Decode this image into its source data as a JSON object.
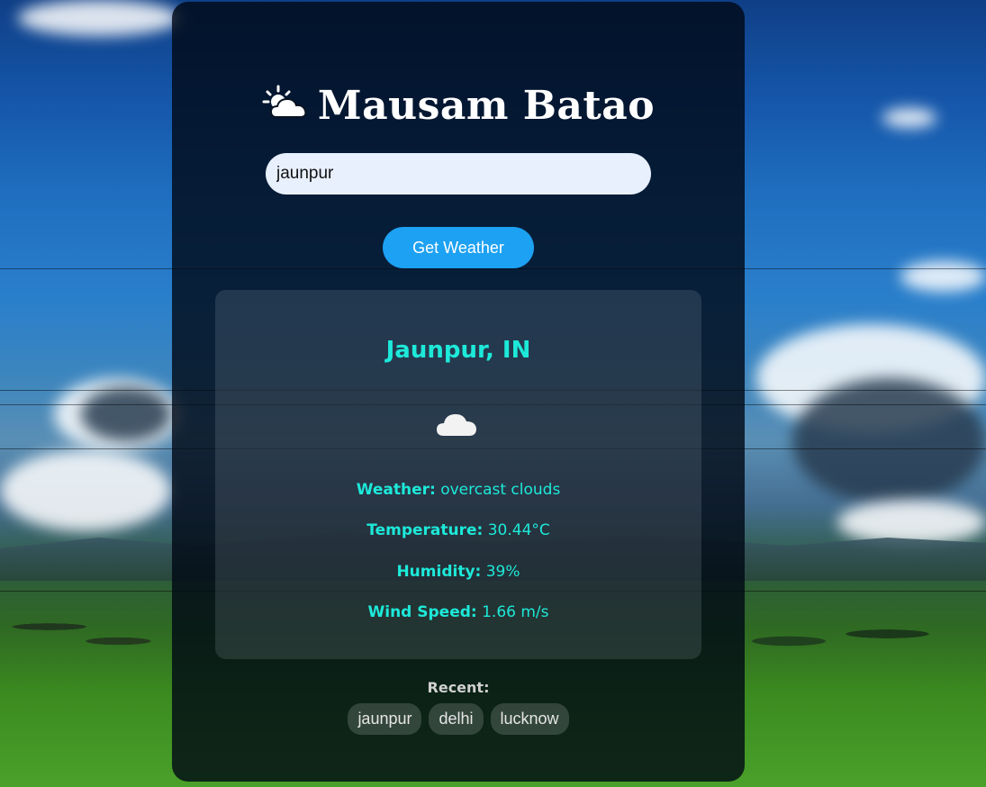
{
  "app": {
    "title": "Mausam Batao",
    "title_icon": "sun-behind-cloud-icon"
  },
  "search": {
    "value": "jaunpur"
  },
  "button": {
    "label": "Get Weather"
  },
  "result": {
    "city": "Jaunpur, IN",
    "weather_icon": "cloud-icon",
    "weather_label": "Weather:",
    "weather_value": "overcast clouds",
    "temperature_label": "Temperature:",
    "temperature_value": "30.44°C",
    "humidity_label": "Humidity:",
    "humidity_value": "39%",
    "wind_label": "Wind Speed:",
    "wind_value": "1.66 m/s"
  },
  "recent": {
    "label": "Recent:",
    "items": [
      "jaunpur",
      "delhi",
      "lucknow"
    ]
  },
  "colors": {
    "accent": "#1de9d9",
    "button": "#1da1f2",
    "input_bg": "#e8f0fe"
  }
}
